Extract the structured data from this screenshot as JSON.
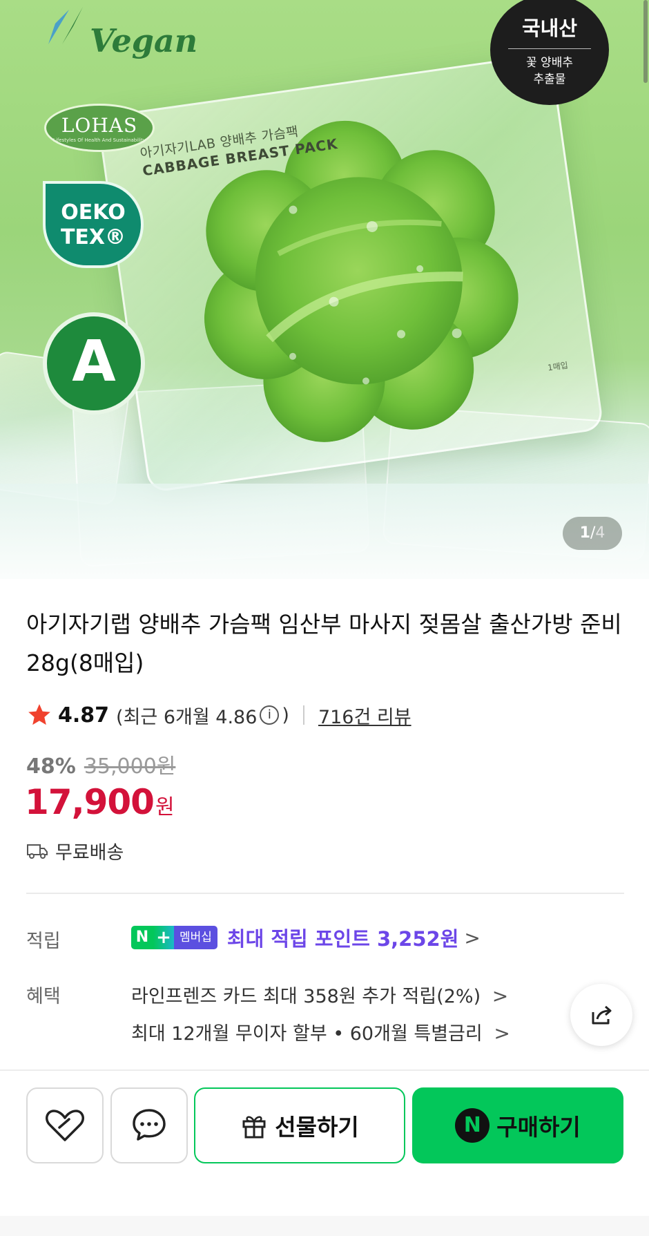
{
  "hero": {
    "badges": {
      "vegan": "Vegan",
      "lohas": "LOHAS",
      "lohas_sub": "Lifestyles Of Health And Sustainability",
      "oeko_line1": "OEKO",
      "oeko_line2": "TEX®",
      "grade": "A",
      "origin_main": "국내산",
      "origin_sub1": "꽃 양배추",
      "origin_sub2": "추출물"
    },
    "pack_title": "아기자기LAB 양배추 가슴팩",
    "pack_subtitle": "CABBAGE BREAST PACK",
    "pack_qty": "1매입",
    "pager_current": "1",
    "pager_sep": "/",
    "pager_total": "4",
    "colors": {
      "background": "#a9dd86",
      "leaf": "#6fbf3a"
    }
  },
  "product": {
    "title": "아기자기랩 양배추 가슴팩 임산부 마사지 젖몸살 출산가방 준비 28g(8매입)",
    "rating_score": "4.87",
    "rating_recent": "(최근 6개월 4.86",
    "rating_recent_close": ")",
    "info_icon": "i",
    "review_count": "716건 리뷰",
    "discount_rate": "48%",
    "original_price": "35,000원",
    "sale_price": "17,900",
    "sale_unit": "원",
    "shipping": "무료배송"
  },
  "benefits": {
    "points_label": "적립",
    "nplus_n": "N",
    "nplus_plus": "+",
    "nplus_member": "멤버십",
    "points_text": "최대 적립 포인트 3,252원",
    "benefit_label": "혜택",
    "benefit_1": "라인프렌즈 카드 최대 358원 추가 적립(2%)",
    "benefit_2": "최대 12개월 무이자 할부 • 60개월 특별금리",
    "chevron": ">"
  },
  "actions": {
    "gift_label": "선물하기",
    "buy_label": "구매하기",
    "buy_badge": "N"
  },
  "colors": {
    "accent": "#03c75a",
    "price": "#d3123a",
    "membership": "#6c46e8"
  }
}
